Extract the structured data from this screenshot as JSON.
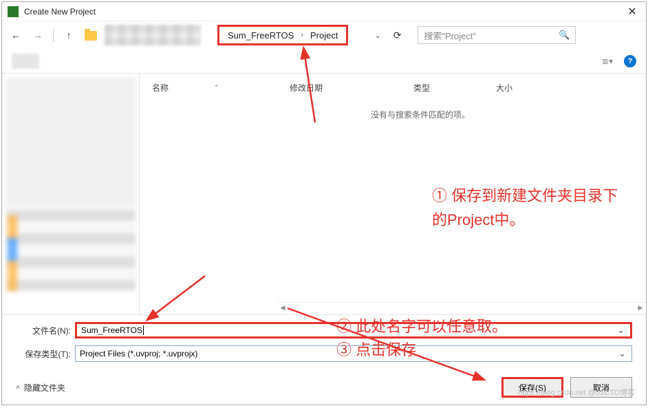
{
  "titlebar": {
    "title": "Create New Project",
    "close_glyph": "✕"
  },
  "toolbar": {
    "back_glyph": "←",
    "forward_glyph": "→",
    "up_glyph": "↑",
    "breadcrumb": {
      "part1": "Sum_FreeRTOS",
      "sep": "›",
      "part2": "Project"
    },
    "dropdown_glyph": "⌄",
    "refresh_glyph": "⟳",
    "search_placeholder": "搜索\"Project\"",
    "search_icon": "🔍"
  },
  "organize": {
    "view_glyph": "≣▾",
    "help_glyph": "?"
  },
  "columns": {
    "name": "名称",
    "date": "修改日期",
    "type": "类型",
    "size": "大小",
    "sort_arrow": "⌃"
  },
  "content": {
    "empty": "没有与搜索条件匹配的项。"
  },
  "annotations": {
    "a1_line1": "① 保存到新建文件夹目录下",
    "a1_line2": "的Project中。",
    "a2": "② 此处名字可以任意取。",
    "a3": "③ 点击保存"
  },
  "bottom": {
    "filename_label": "文件名(N):",
    "filename_value": "Sum_FreeRTOS",
    "filetype_label": "保存类型(T):",
    "filetype_value": "Project Files (*.uvproj; *.uvprojx)",
    "hide_folders": "隐藏文件夹",
    "hide_chev": "˄",
    "save": "保存(S)",
    "cancel": "取消"
  },
  "watermark": "https://blog.csdn.net @51CTO博客",
  "scroll": {
    "left": "◀",
    "right": "▶"
  }
}
